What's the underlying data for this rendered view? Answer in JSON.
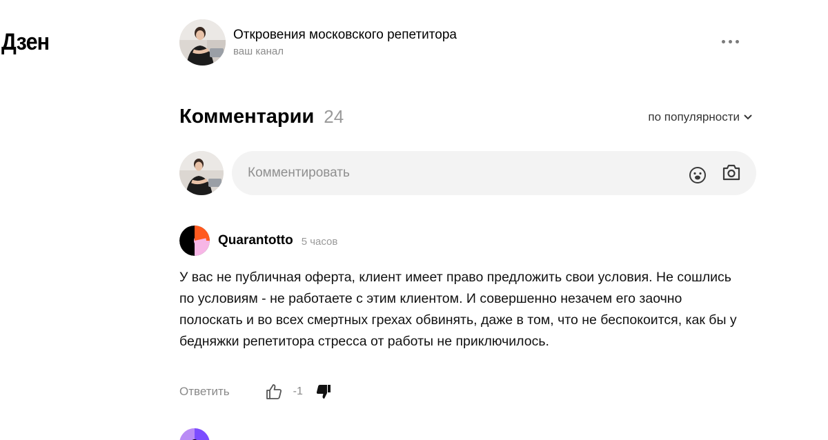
{
  "app": {
    "logo": "Дзен"
  },
  "channel": {
    "title": "Откровения московского репетитора",
    "subtitle": "ваш канал"
  },
  "comments_section": {
    "title": "Комментарии",
    "count": "24",
    "sort_label": "по популярности",
    "input_placeholder": "Комментировать"
  },
  "comments": [
    {
      "author": "Quarantotto",
      "time": "5 часов",
      "text": "У вас не публичная оферта, клиент имеет право предложить свои условия. Не сошлись по условиям - не работаете с этим клиентом. И совершенно незачем его заочно полоскать и во всех смертных грехах обвинять, даже в том, что не беспокоится, как бы у бедняжки репетитора стресса от работы не приключилось.",
      "reply_label": "Ответить",
      "score": "-1"
    }
  ],
  "colors": {
    "accent_orange": "#ff5a1f",
    "accent_pink": "#f7b6e6",
    "accent_purple": "#7c4dff",
    "input_bg": "#f3f3f3"
  },
  "icons": [
    "dots-menu-icon",
    "chevron-down-icon",
    "emoji-icon",
    "camera-icon",
    "thumb-up-icon",
    "thumb-down-icon"
  ]
}
